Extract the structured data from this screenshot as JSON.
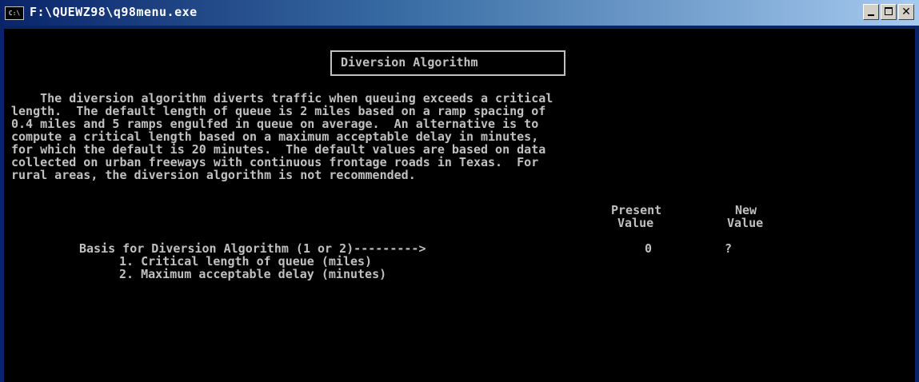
{
  "window": {
    "title": "F:\\QUEWZ98\\q98menu.exe",
    "icon_label": "C:\\",
    "minimize_label": "_",
    "maximize_label": "□",
    "close_label": "✕"
  },
  "console": {
    "heading": "Diversion Algorithm",
    "paragraph": [
      "    The diversion algorithm diverts traffic when queuing exceeds a critical",
      "length.  The default length of queue is 2 miles based on a ramp spacing of",
      "0.4 miles and 5 ramps engulfed in queue on average.  An alternative is to",
      "compute a critical length based on a maximum acceptable delay in minutes,",
      "for which the default is 20 minutes.  The default values are based on data",
      "collected on urban freeways with continuous frontage roads in Texas.  For",
      "rural areas, the diversion algorithm is not recommended."
    ],
    "column_present": [
      "Present",
      "Value"
    ],
    "column_new": [
      "New",
      "Value"
    ],
    "prompt_label": "Basis for Diversion Algorithm (1 or 2)--------->",
    "present_value": "0",
    "new_value": "?",
    "options": [
      "1. Critical length of queue (miles)",
      "2. Maximum acceptable delay (minutes)"
    ]
  }
}
